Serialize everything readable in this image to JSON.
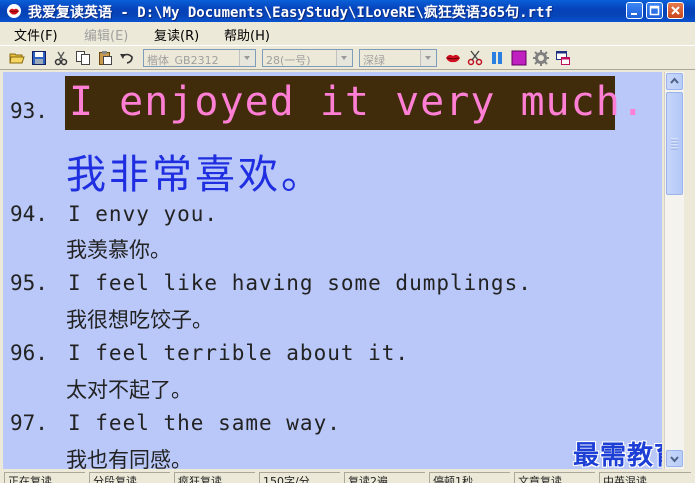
{
  "window": {
    "title": "我爱复读英语 - D:\\My Documents\\EasyStudy\\ILoveRE\\疯狂英语365句.rtf"
  },
  "menu": {
    "items": [
      {
        "label": "文件(F)",
        "enabled": true
      },
      {
        "label": "编辑(E)",
        "enabled": false
      },
      {
        "label": "复读(R)",
        "enabled": true
      },
      {
        "label": "帮助(H)",
        "enabled": true
      }
    ]
  },
  "toolbar": {
    "font_name": "楷体_GB2312",
    "font_size": "28(一号)",
    "font_color": "深绿",
    "icons": [
      "open-file-icon",
      "save-icon",
      "cut-icon",
      "copy-icon",
      "paste-icon",
      "undo-icon",
      "lips-icon",
      "scissors-icon",
      "pause-icon",
      "color-square-icon",
      "gear-icon",
      "window-icon"
    ]
  },
  "document": {
    "highlight": {
      "number": "93.",
      "english": "I enjoyed it very much.",
      "chinese": "我非常喜欢。"
    },
    "entries": [
      {
        "number": "94.",
        "english": "I envy you.",
        "chinese": "我羡慕你。"
      },
      {
        "number": "95.",
        "english": "I feel like having some dumplings.",
        "chinese": "我很想吃饺子。"
      },
      {
        "number": "96.",
        "english": "I feel terrible about it.",
        "chinese": "太对不起了。"
      },
      {
        "number": "97.",
        "english": "I feel the same way.",
        "chinese": "我也有同感。"
      }
    ],
    "watermark": "最需教育",
    "background_color": "#b9c8f8",
    "highlight_bg": "#402c0a",
    "highlight_en_color": "#ff7fd4",
    "highlight_cn_color": "#1e2ee0"
  },
  "statusbar": {
    "cells": [
      "正在复读",
      "分段复读",
      "疯狂复读",
      "150字/分",
      "复读2遍",
      "停顿1秒",
      "文章复读",
      "中英混读"
    ]
  }
}
